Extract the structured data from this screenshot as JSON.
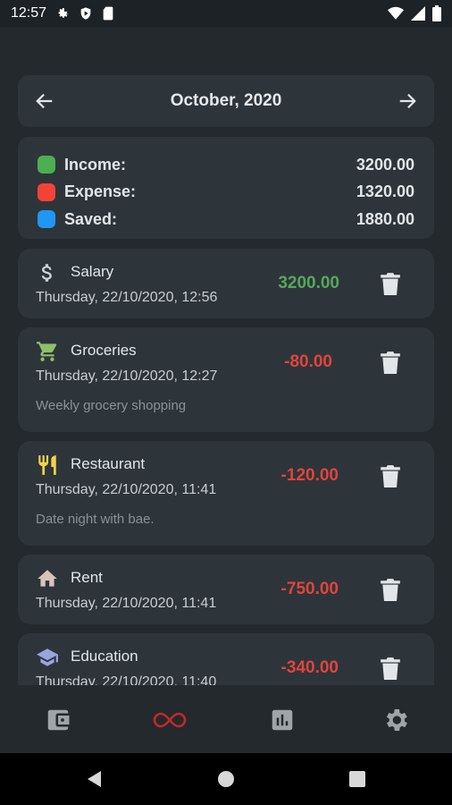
{
  "status_bar": {
    "time": "12:57"
  },
  "header": {
    "month": "October, 2020"
  },
  "summary": {
    "income": {
      "label": "Income:",
      "value": "3200.00",
      "color": "#4caf50"
    },
    "expense": {
      "label": "Expense:",
      "value": "1320.00",
      "color": "#f44336"
    },
    "saved": {
      "label": "Saved:",
      "value": "1880.00",
      "color": "#2196f3"
    }
  },
  "transactions": [
    {
      "icon": "dollar-icon",
      "title": "Salary",
      "date": "Thursday, 22/10/2020, 12:56",
      "note": "",
      "amount": "3200.00",
      "type": "income"
    },
    {
      "icon": "cart-icon",
      "title": "Groceries",
      "date": "Thursday, 22/10/2020, 12:27",
      "note": "Weekly grocery shopping",
      "amount": "-80.00",
      "type": "expense"
    },
    {
      "icon": "fork-knife-icon",
      "title": "Restaurant",
      "date": "Thursday, 22/10/2020, 11:41",
      "note": "Date night with bae.",
      "amount": "-120.00",
      "type": "expense"
    },
    {
      "icon": "home-icon",
      "title": "Rent",
      "date": "Thursday, 22/10/2020, 11:41",
      "note": "",
      "amount": "-750.00",
      "type": "expense"
    },
    {
      "icon": "graduation-cap-icon",
      "title": "Education",
      "date": "Thursday, 22/10/2020, 11:40",
      "note": "",
      "amount": "-340.00",
      "type": "expense"
    }
  ],
  "bottom_nav": {
    "items": [
      {
        "name": "wallet",
        "icon": "wallet-icon",
        "active": false
      },
      {
        "name": "transactions",
        "icon": "infinity-icon",
        "active": true
      },
      {
        "name": "statistics",
        "icon": "bar-chart-icon",
        "active": false
      },
      {
        "name": "settings",
        "icon": "gear-icon",
        "active": false
      }
    ]
  },
  "colors": {
    "accent": "#c62828",
    "card": "#2e353a",
    "background": "#23292d"
  }
}
